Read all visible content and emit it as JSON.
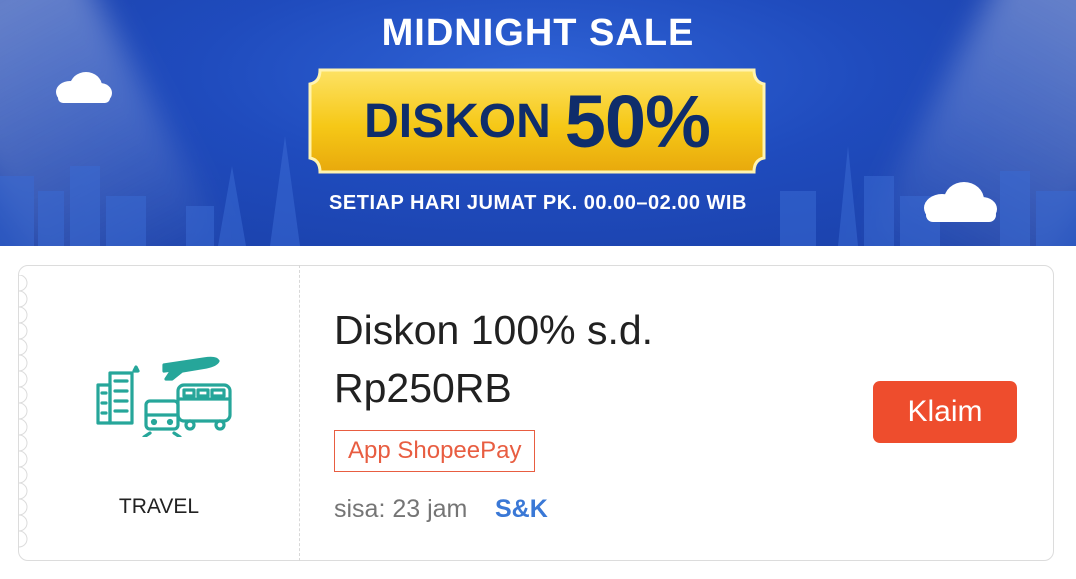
{
  "banner": {
    "title": "MIDNIGHT SALE",
    "discount_word": "DISKON",
    "discount_value": "50%",
    "schedule": "SETIAP HARI JUMAT PK. 00.00–02.00 WIB"
  },
  "voucher": {
    "category_label": "TRAVEL",
    "category_icon": "travel-icon",
    "title_line1": "Diskon 100% s.d.",
    "title_line2": "Rp250RB",
    "tag": "App ShopeePay",
    "expiry": "sisa: 23 jam",
    "terms_link": "S&K",
    "claim_label": "Klaim"
  },
  "colors": {
    "banner_blue": "#1f4bbd",
    "ticket_gold": "#f6c817",
    "accent_orange": "#ee4d2d",
    "icon_teal": "#26a69a",
    "link_blue": "#3a78d6"
  }
}
